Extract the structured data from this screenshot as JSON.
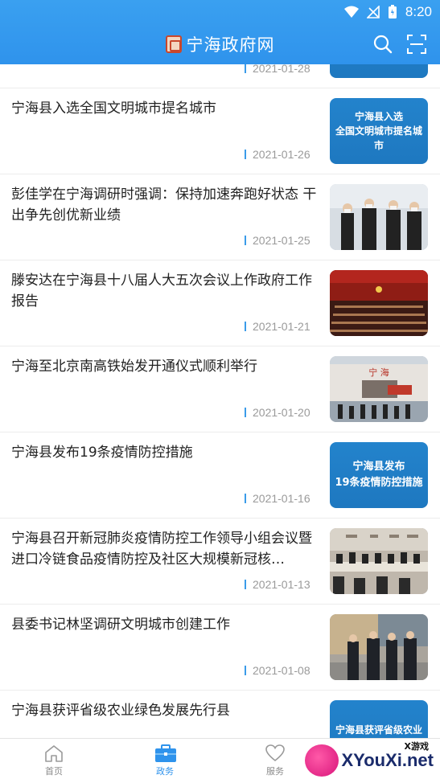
{
  "status_bar": {
    "time": "8:20"
  },
  "header": {
    "title": "宁海政府网"
  },
  "news": [
    {
      "title": "",
      "date": "2021-01-28",
      "thumb_type": "text",
      "thumb_text": ""
    },
    {
      "title": "宁海县入选全国文明城市提名城市",
      "date": "2021-01-26",
      "thumb_type": "text",
      "thumb_text": "宁海县入选\n全国文明城市提名城市"
    },
    {
      "title": "彭佳学在宁海调研时强调：保持加速奔跑好状态 干出争先创优新业绩",
      "date": "2021-01-25",
      "thumb_type": "photo",
      "thumb_text": ""
    },
    {
      "title": "滕安达在宁海县十八届人大五次会议上作政府工作报告",
      "date": "2021-01-21",
      "thumb_type": "photo",
      "thumb_text": ""
    },
    {
      "title": "宁海至北京南高铁始发开通仪式顺利举行",
      "date": "2021-01-20",
      "thumb_type": "photo",
      "thumb_text": "宁 海"
    },
    {
      "title": "宁海县发布19条疫情防控措施",
      "date": "2021-01-16",
      "thumb_type": "text",
      "thumb_text": "宁海县发布\n19条疫情防控措施"
    },
    {
      "title": "宁海县召开新冠肺炎疫情防控工作领导小组会议暨进口冷链食品疫情防控及社区大规模新冠核…",
      "date": "2021-01-13",
      "thumb_type": "photo",
      "thumb_text": ""
    },
    {
      "title": "县委书记林坚调研文明城市创建工作",
      "date": "2021-01-08",
      "thumb_type": "photo",
      "thumb_text": ""
    },
    {
      "title": "宁海县获评省级农业绿色发展先行县",
      "date": "",
      "thumb_type": "text",
      "thumb_text": "宁海县获评省级农业"
    }
  ],
  "tabs": [
    {
      "label": "首页",
      "icon": "home-icon",
      "active": false
    },
    {
      "label": "政务",
      "icon": "briefcase-icon",
      "active": true
    },
    {
      "label": "服务",
      "icon": "heart-icon",
      "active": false
    }
  ],
  "watermark": {
    "text": "XYouXi.net",
    "small": "X游戏"
  },
  "colors": {
    "primary": "#2f93ec",
    "thumb_blue": "#2383cc",
    "date_accent": "#3a9be9"
  }
}
